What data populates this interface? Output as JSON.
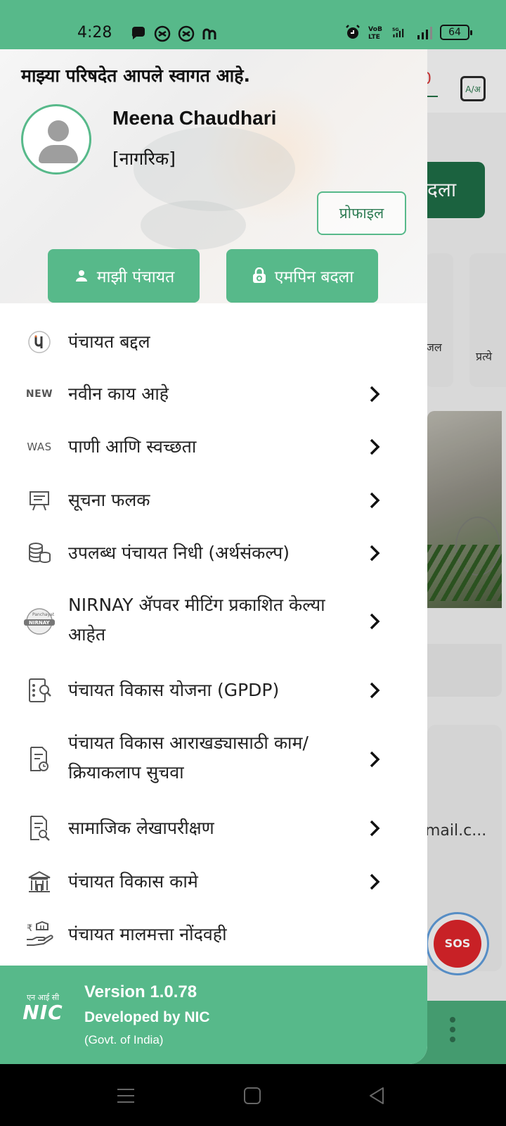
{
  "status_bar": {
    "time": "4:28",
    "network": "VoLTE 5G",
    "battery": "64"
  },
  "background_app": {
    "notification_count": "0",
    "lang_icon": "A/अ",
    "green_button_partial": "दला",
    "card1_label": "जल",
    "card2_label": "प्रत्ये",
    "email_partial": "mail.c...",
    "sos_label": "SOS"
  },
  "drawer": {
    "welcome": "माझ्या परिषदेत आपले स्वागत आहे.",
    "user_name": "Meena Chaudhari",
    "user_role": "[नागरिक]",
    "profile_button": "प्रोफाइल",
    "my_panchayat_button": "माझी पंचायत",
    "change_mpin_button": "एमपिन बदला",
    "menu": [
      {
        "label": "पंचायत बद्दल",
        "icon": "panchayat-logo-icon",
        "icon_text": "P",
        "has_chevron": false
      },
      {
        "label": "नवीन काय आहे",
        "icon": "new-icon",
        "icon_text": "NEW",
        "has_chevron": true
      },
      {
        "label": "पाणी आणि स्वच्छता",
        "icon": "was-icon",
        "icon_text": "WAS",
        "has_chevron": true
      },
      {
        "label": "सूचना फलक",
        "icon": "notice-board-icon",
        "has_chevron": true
      },
      {
        "label": "उपलब्ध पंचायत निधी (अर्थसंकल्प)",
        "icon": "coins-icon",
        "has_chevron": true
      },
      {
        "label": "NIRNAY ॲपवर मीटिंग प्रकाशित केल्या आहेत",
        "icon": "nirnay-logo-icon",
        "icon_text": "NIRNAY",
        "has_chevron": true
      },
      {
        "label": "पंचायत विकास योजना (GPDP)",
        "icon": "plan-search-icon",
        "has_chevron": true
      },
      {
        "label": "पंचायत विकास आराखड्यासाठी काम/ क्रियाकलाप सुचवा",
        "icon": "document-clock-icon",
        "has_chevron": true
      },
      {
        "label": "सामाजिक लेखापरीक्षण",
        "icon": "audit-search-icon",
        "has_chevron": true
      },
      {
        "label": "पंचायत विकास कामे",
        "icon": "building-icon",
        "has_chevron": true
      },
      {
        "label": "पंचायत मालमत्ता नोंदवही",
        "icon": "asset-hand-icon",
        "has_chevron": false
      }
    ],
    "footer": {
      "logo_hindi": "एन आई सी",
      "logo_en": "NIC",
      "version": "Version 1.0.78",
      "developed_by": "Developed by NIC",
      "govt": "(Govt. of India)"
    }
  },
  "colors": {
    "accent": "#57b98a",
    "accent_dark": "#2f7d55"
  }
}
